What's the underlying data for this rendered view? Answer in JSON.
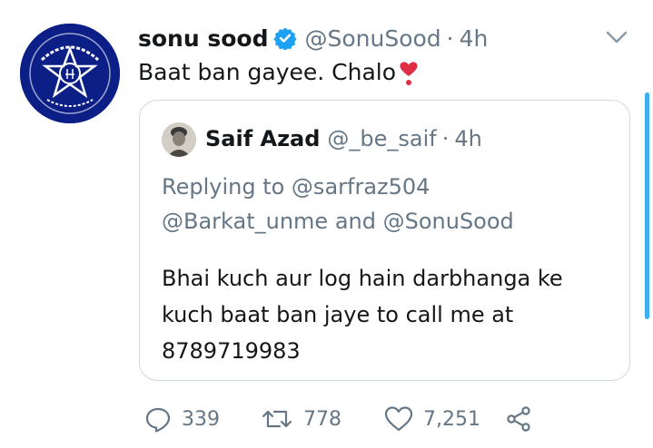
{
  "tweet": {
    "author_name": "sonu sood",
    "author_handle": "@SonuSood",
    "separator": "·",
    "time": "4h",
    "text": "Baat ban gayee. Chalo",
    "emoji": "heart-exclamation"
  },
  "quoted": {
    "author_name": "Saif Azad",
    "author_handle": "@_be_saif",
    "separator": "·",
    "time": "4h",
    "replying_line1": "Replying to @sarfraz504",
    "replying_line2": "@Barkat_unme and @SonuSood",
    "body_line1": "Bhai kuch aur log hain darbhanga ke",
    "body_line2": "kuch baat ban jaye to call me at",
    "body_line3": "8789719983"
  },
  "actions": {
    "replies": "339",
    "retweets": "778",
    "likes": "7,251"
  },
  "colors": {
    "text": "#14171a",
    "secondary": "#657786",
    "verified": "#1da1f2",
    "avatar_bg": "#0c1f86",
    "heart": "#e0245e"
  }
}
